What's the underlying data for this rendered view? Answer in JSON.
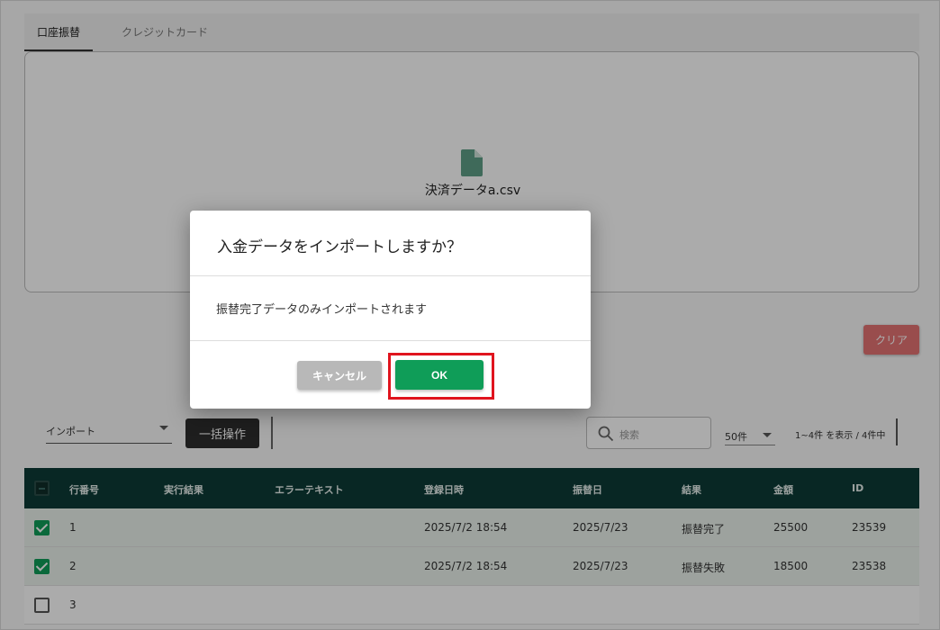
{
  "tabs": [
    {
      "label": "口座振替"
    },
    {
      "label": "クレジットカード"
    }
  ],
  "dropzone": {
    "file_name": "決済データa.csv",
    "file_icon": "file-icon"
  },
  "clear_button": "クリア",
  "toolbar": {
    "import_select": "インポート",
    "bulk_button": "一括操作",
    "search_placeholder": "検索",
    "per_page": "50件",
    "range_text": "1~4件 を表示 / 4件中"
  },
  "table": {
    "headers": [
      "行番号",
      "実行結果",
      "エラーテキスト",
      "登録日時",
      "振替日",
      "結果",
      "金額",
      "ID"
    ],
    "rows": [
      {
        "checked": true,
        "no": "1",
        "result": "",
        "error": "",
        "registered": "2025/7/2 18:54",
        "transfer_date": "2025/7/23",
        "status": "振替完了",
        "amount": "25500",
        "id": "23539"
      },
      {
        "checked": true,
        "no": "2",
        "result": "",
        "error": "",
        "registered": "2025/7/2 18:54",
        "transfer_date": "2025/7/23",
        "status": "振替失敗",
        "amount": "18500",
        "id": "23538"
      },
      {
        "checked": false,
        "no": "3",
        "result": "",
        "error": "",
        "registered": "",
        "transfer_date": "",
        "status": "",
        "amount": "",
        "id": ""
      }
    ]
  },
  "dialog": {
    "title": "入金データをインポートしますか？",
    "body": "振替完了データのみインポートされます",
    "cancel_label": "キャンセル",
    "ok_label": "OK"
  },
  "colors": {
    "accent": "#0f9d58",
    "table_header": "#0d3b36",
    "clear": "#e57373",
    "highlight": "#e0141e"
  }
}
